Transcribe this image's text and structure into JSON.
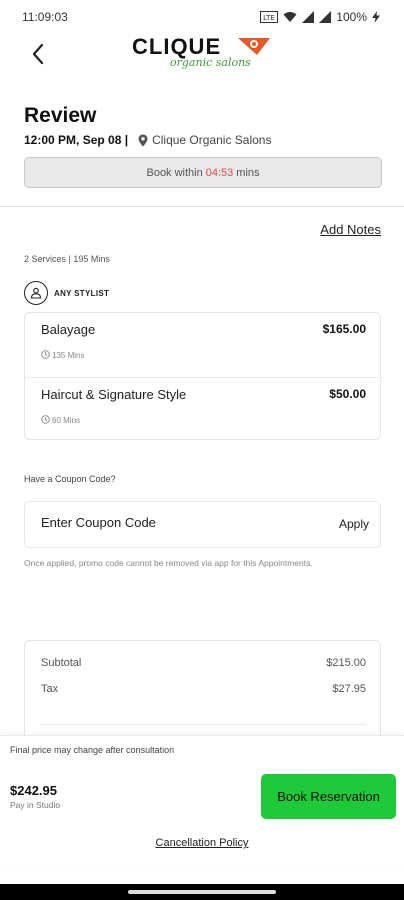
{
  "status_bar": {
    "time": "11:09:03",
    "battery": "100%",
    "icons": [
      "lte-icon",
      "wifi-icon",
      "signal-icon",
      "signal-icon",
      "battery-charging-icon"
    ]
  },
  "header": {
    "logo_text": "CLIQUE",
    "logo_subtext": "organic salons",
    "back_icon": "chevron-left-icon"
  },
  "review": {
    "title": "Review",
    "datetime": "12:00 PM, Sep 08 |",
    "salon": "Clique Organic Salons",
    "timer_prefix": "Book within",
    "timer_value": "04:53",
    "timer_suffix": "mins"
  },
  "notes": {
    "add_label": "Add Notes"
  },
  "services": {
    "summary": "2 Services | 195 Mins",
    "stylist_label": "ANY STYLIST",
    "items": [
      {
        "name": "Balayage",
        "price": "$165.00",
        "duration": "135 Mins"
      },
      {
        "name": "Haircut & Signature Style",
        "price": "$50.00",
        "duration": "60 Mins"
      }
    ]
  },
  "coupon": {
    "question": "Have a Coupon Code?",
    "placeholder": "Enter Coupon Code",
    "apply_label": "Apply",
    "note": "Once applied, promo code cannot be removed via app for this Appointments."
  },
  "totals": {
    "subtotal_label": "Subtotal",
    "subtotal_value": "$215.00",
    "tax_label": "Tax",
    "tax_value": "$27.95"
  },
  "footer": {
    "final_note": "Final price may change after consultation",
    "total": "$242.95",
    "pay_label": "Pay in Studio",
    "book_label": "Book Reservation",
    "cancellation_label": "Cancellation Policy"
  },
  "colors": {
    "accent_green": "#1ec93a",
    "timer_red": "#e04a4a",
    "logo_orange": "#e8572a",
    "logo_green": "#3f9a3a"
  }
}
